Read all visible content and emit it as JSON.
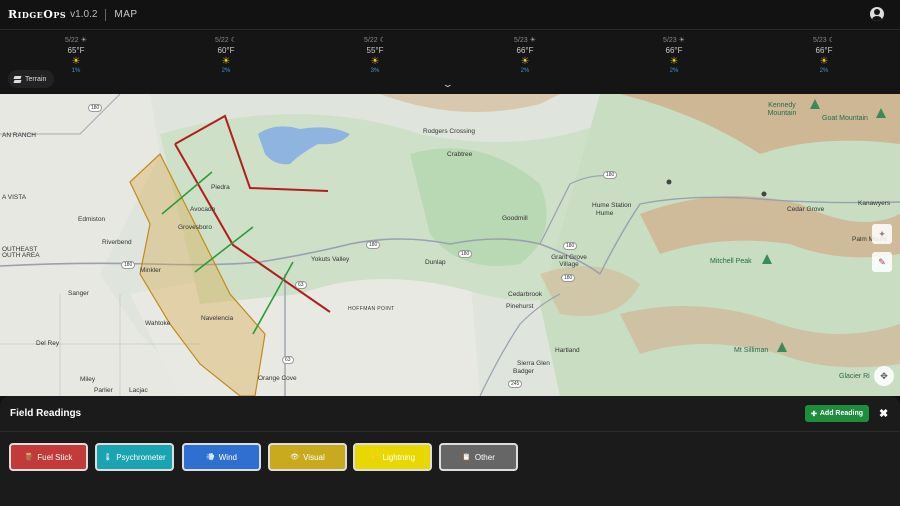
{
  "app": {
    "name": "RidgeOps",
    "version": "v1.0.2",
    "section": "MAP"
  },
  "forecast": [
    {
      "date": "5/22",
      "sym": "☀",
      "temp": "65°F",
      "pct": "1%"
    },
    {
      "date": "5/22",
      "sym": "☾",
      "temp": "60°F",
      "pct": "2%"
    },
    {
      "date": "5/22",
      "sym": "☾",
      "temp": "55°F",
      "pct": "3%"
    },
    {
      "date": "5/23",
      "sym": "☀",
      "temp": "66°F",
      "pct": "2%"
    },
    {
      "date": "5/23",
      "sym": "☀",
      "temp": "66°F",
      "pct": "2%"
    },
    {
      "date": "5/23",
      "sym": "☾",
      "temp": "66°F",
      "pct": "2%"
    }
  ],
  "layer_toggle": {
    "label": "Terrain"
  },
  "map": {
    "places": [
      "Rodgers Crossing",
      "Crabtree",
      "Piedra",
      "Avocado",
      "Edmiston",
      "Riverbend",
      "Minkler",
      "Sanger",
      "Wahtoke",
      "Del Rey",
      "Navelencia",
      "Orange Cove",
      "Yokuts Valley",
      "Dunlap",
      "Goodmill",
      "Hume Station",
      "Hume",
      "Cedar Grove",
      "Grant Grove Village",
      "Cedarbrook",
      "Pinehurst",
      "Hartland",
      "Sierra Glen",
      "Badger",
      "Miley",
      "Parlier",
      "Lacjac",
      "Kanawyers",
      "Palm Mount",
      "Glacier Ri",
      "Kennedy Mountain",
      "Goat Mountain",
      "Mitchell Peak",
      "Mt Silliman",
      "HOFFMAN POINT",
      "AN RANCH",
      "A VISTA",
      "OUTHEAST",
      "OUTH AREA",
      "Grovesboro"
    ],
    "routes": [
      "180",
      "180",
      "180",
      "180",
      "180",
      "180",
      "180",
      "63",
      "63",
      "245"
    ]
  },
  "panel": {
    "title": "Field Readings",
    "add_label": "Add Reading",
    "close_glyph": "✖",
    "readings": [
      {
        "label": "Fuel Stick",
        "icon": "fuel-stick-icon",
        "color": "#c23a3a"
      },
      {
        "label": "Psychrometer",
        "icon": "thermometer-icon",
        "color": "#1aa3b0"
      },
      {
        "label": "Wind",
        "icon": "wind-icon",
        "color": "#2f6fcf"
      },
      {
        "label": "Visual",
        "icon": "eye-icon",
        "color": "#c9aa1e"
      },
      {
        "label": "Lightning",
        "icon": "lightning-icon",
        "color": "#e8d800"
      },
      {
        "label": "Other",
        "icon": "clipboard-icon",
        "color": "#666666"
      }
    ]
  }
}
